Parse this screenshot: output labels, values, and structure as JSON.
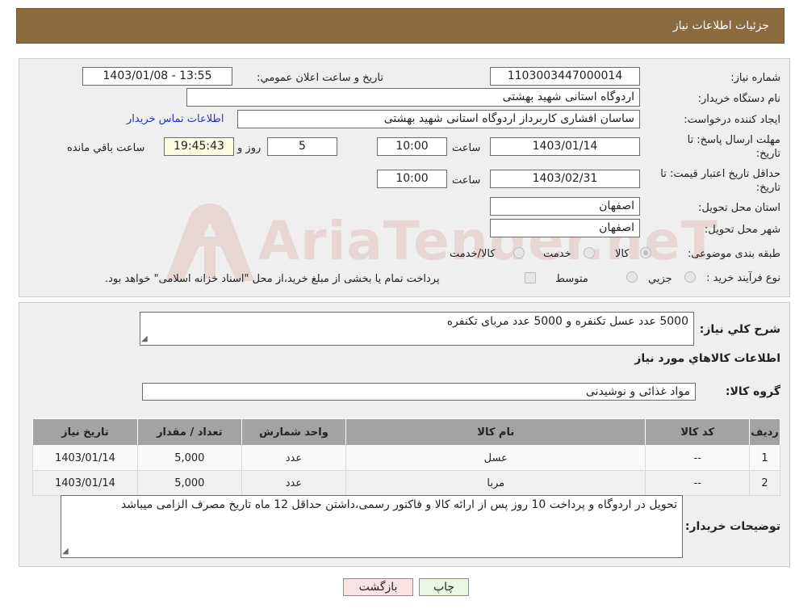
{
  "header": {
    "title": "جزئیات اطلاعات نیاز"
  },
  "info": {
    "need_number_label": "شماره نیاز:",
    "need_number": "1103003447000014",
    "announce_label": "تاریخ و ساعت اعلان عمومي:",
    "announce_value": "1403/01/08 - 13:55",
    "buyer_label": "نام دستگاه خريدار:",
    "buyer_value": "اردوگاه استانی شهید بهشتی",
    "creator_label": "ايجاد کننده درخواست:",
    "creator_value": "ساسان  افشاری کاربرداز اردوگاه استانی شهید بهشتی",
    "contact_link": "اطلاعات تماس خريدار",
    "deadline_label_1": "مهلت ارسال پاسخ: تا",
    "deadline_label_2": "تاريخ:",
    "deadline_date": "1403/01/14",
    "time_label": "ساعت",
    "deadline_time": "10:00",
    "days_value": "5",
    "days_label": "روز و",
    "remaining_time": "19:45:43",
    "remaining_label": "ساعت باقي مانده",
    "validity_label_1": "حداقل تاريخ اعتبار قيمت: تا",
    "validity_label_2": "تاريخ:",
    "validity_date": "1403/02/31",
    "validity_time_label": "ساعت",
    "validity_time": "10:00",
    "province_label": "استان محل تحويل:",
    "province_value": "اصفهان",
    "city_label": "شهر محل تحويل:",
    "city_value": "اصفهان",
    "category_label": "طبقه بندی موضوعی:",
    "category_options": [
      "کالا",
      "خدمت",
      "کالا/خدمت"
    ],
    "process_label": "نوع فرآيند خريد :",
    "process_options": [
      "جزيي",
      "متوسط"
    ],
    "payment_note": "پرداخت تمام يا بخشی از مبلغ خريد،از محل \"اسناد خزانه اسلامی\" خواهد بود."
  },
  "summary": {
    "desc_label": "شرح کلي نياز:",
    "desc_value": "5000 عدد عسل تکنفره و 5000 عدد مربای تکنفره",
    "goods_title": "اطلاعات کالاهاي مورد نياز",
    "group_label": "گروه کالا:",
    "group_value": "مواد غذائی و نوشیدنی"
  },
  "table": {
    "headers": [
      "رديف",
      "کد کالا",
      "نام کالا",
      "واحد شمارش",
      "تعداد / مقدار",
      "تاريخ نياز"
    ],
    "rows": [
      [
        "1",
        "--",
        "عسل",
        "عدد",
        "5,000",
        "1403/01/14"
      ],
      [
        "2",
        "--",
        "مربا",
        "عدد",
        "5,000",
        "1403/01/14"
      ]
    ]
  },
  "notes": {
    "label": "توضيحات خريدار:",
    "value": "تحویل در اردوگاه و پرداخت 10 روز پس از ارائه کالا و فاکتور رسمی،داشتن حداقل 12 ماه تاریخ مصرف الزامی میباشد"
  },
  "buttons": {
    "print": "چاپ",
    "back": "بازگشت"
  },
  "watermark": "AriaTender.neT",
  "colors": {
    "header": "#8b6b3d",
    "print_btn": "#e8f8e0",
    "back_btn": "#fbe3e3",
    "watermark": "#c0392b"
  }
}
